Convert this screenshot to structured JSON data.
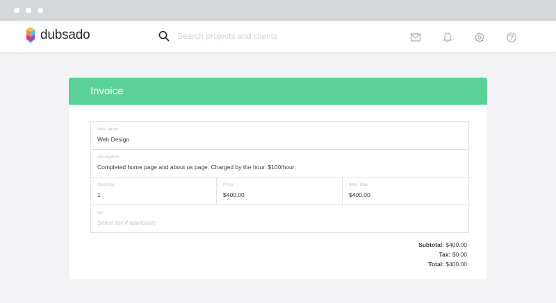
{
  "app": {
    "logo_text": "dubsado"
  },
  "search": {
    "placeholder": "Search projects and clients"
  },
  "nav": {
    "icons": [
      "mail-icon",
      "bell-icon",
      "gear-icon",
      "help-icon"
    ]
  },
  "invoice": {
    "title": "Invoice",
    "item_name": {
      "label": "Item name",
      "value": "Web Design"
    },
    "description": {
      "label": "description",
      "value": "Completed home page and about us page. Charged by the hour. $100/hour."
    },
    "quantity": {
      "label": "Quantity",
      "value": "1"
    },
    "price": {
      "label": "Price",
      "value": "$400.00"
    },
    "item_total": {
      "label": "Item Total",
      "value": "$400.00"
    },
    "tax": {
      "label": "tax",
      "placeholder": "Select tax if applicable"
    },
    "totals": {
      "subtotal_label": "Subtotal:",
      "subtotal_value": "$400.00",
      "tax_label": "Tax:",
      "tax_value": "$0.00",
      "total_label": "Total:",
      "total_value": "$400.00"
    }
  },
  "colors": {
    "accent": "#5bd295",
    "background": "#f3f2f4",
    "chrome": "#d5d8db"
  }
}
